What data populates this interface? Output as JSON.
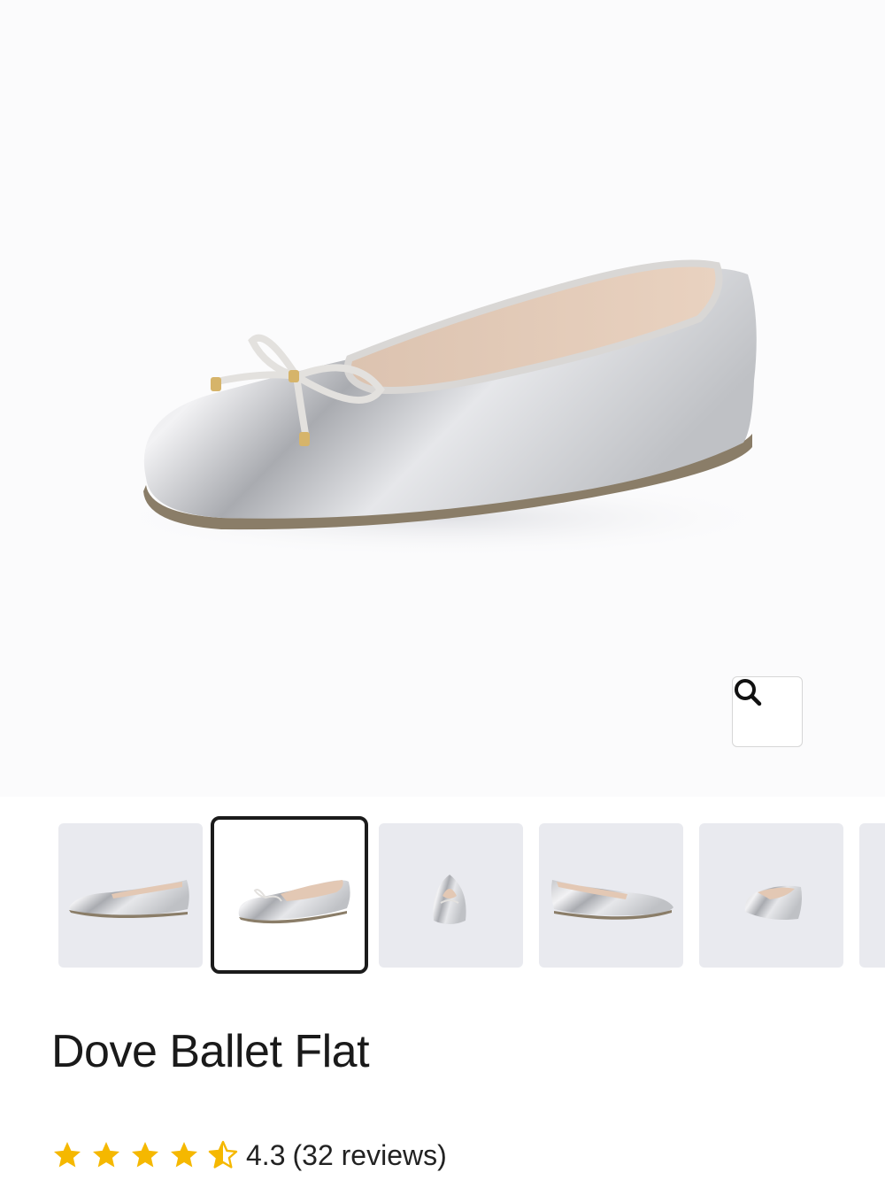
{
  "product": {
    "name": "Dove Ballet Flat",
    "rating_value": "4.3",
    "reviews_text": "(32 reviews)",
    "rating": 4.3,
    "rating_max": 5
  },
  "gallery": {
    "selected_index": 1,
    "thumbnail_views": [
      "side",
      "three-quarter",
      "front",
      "side-reverse",
      "back",
      "partial"
    ]
  },
  "colors": {
    "star": "#f5b800",
    "selected_border": "#1b1b1b",
    "thumb_bg": "#e9eaef",
    "shoe_silver": "#d9dadd"
  },
  "icons": {
    "zoom": "search-icon",
    "star_full": "star-icon",
    "star_half": "star-half-icon"
  }
}
